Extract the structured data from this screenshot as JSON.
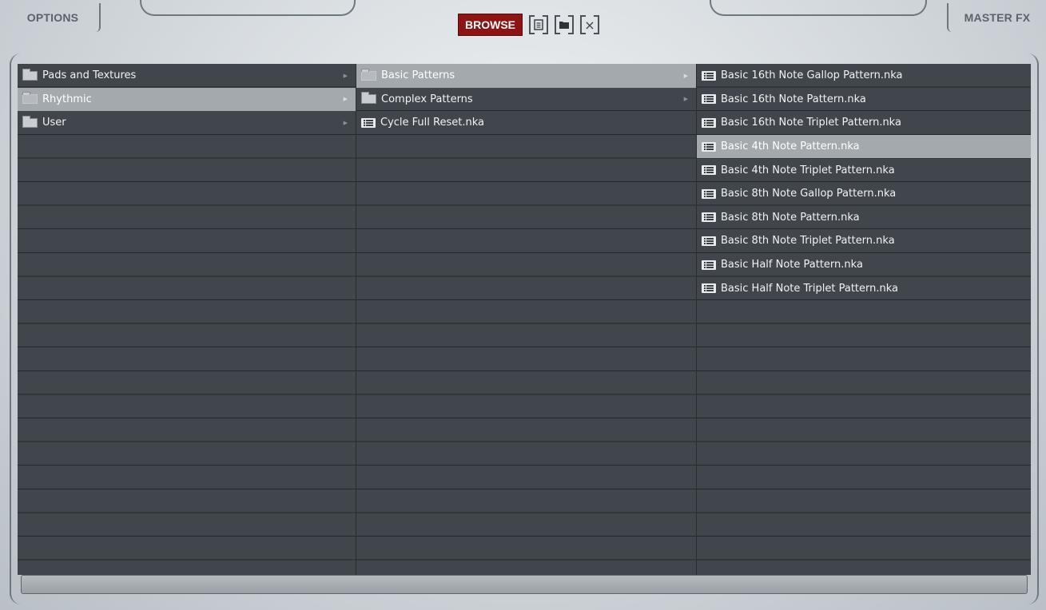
{
  "header": {
    "options_label": "OPTIONS",
    "master_fx_label": "MASTER FX",
    "browse_label": "BROWSE",
    "save_icon": "save-icon",
    "folder_icon": "folder-icon",
    "close_icon": "close-icon",
    "close_glyph": "×"
  },
  "browser": {
    "column1": [
      {
        "label": "Pads and Textures",
        "type": "folder",
        "selected": false
      },
      {
        "label": "Rhythmic",
        "type": "folder",
        "selected": true
      },
      {
        "label": "User",
        "type": "folder",
        "selected": false
      }
    ],
    "column2": [
      {
        "label": "Basic Patterns",
        "type": "folder",
        "selected": true
      },
      {
        "label": "Complex Patterns",
        "type": "folder",
        "selected": false
      },
      {
        "label": "Cycle Full Reset.nka",
        "type": "file",
        "selected": false
      }
    ],
    "column3": [
      {
        "label": "Basic 16th Note Gallop Pattern.nka",
        "type": "file",
        "selected": false
      },
      {
        "label": "Basic 16th Note Pattern.nka",
        "type": "file",
        "selected": false
      },
      {
        "label": "Basic 16th Note Triplet Pattern.nka",
        "type": "file",
        "selected": false
      },
      {
        "label": "Basic 4th Note Pattern.nka",
        "type": "file",
        "selected": true
      },
      {
        "label": "Basic 4th Note Triplet Pattern.nka",
        "type": "file",
        "selected": false
      },
      {
        "label": "Basic 8th Note Gallop Pattern.nka",
        "type": "file",
        "selected": false
      },
      {
        "label": "Basic 8th Note Pattern.nka",
        "type": "file",
        "selected": false
      },
      {
        "label": "Basic 8th Note Triplet Pattern.nka",
        "type": "file",
        "selected": false
      },
      {
        "label": "Basic Half Note Pattern.nka",
        "type": "file",
        "selected": false
      },
      {
        "label": "Basic Half Note Triplet Pattern.nka",
        "type": "file",
        "selected": false
      }
    ]
  },
  "colors": {
    "accent": "#8c1414",
    "panel_bg": "#41464c",
    "row_selected": "#a4a9ad",
    "text": "#f1f2f3"
  }
}
